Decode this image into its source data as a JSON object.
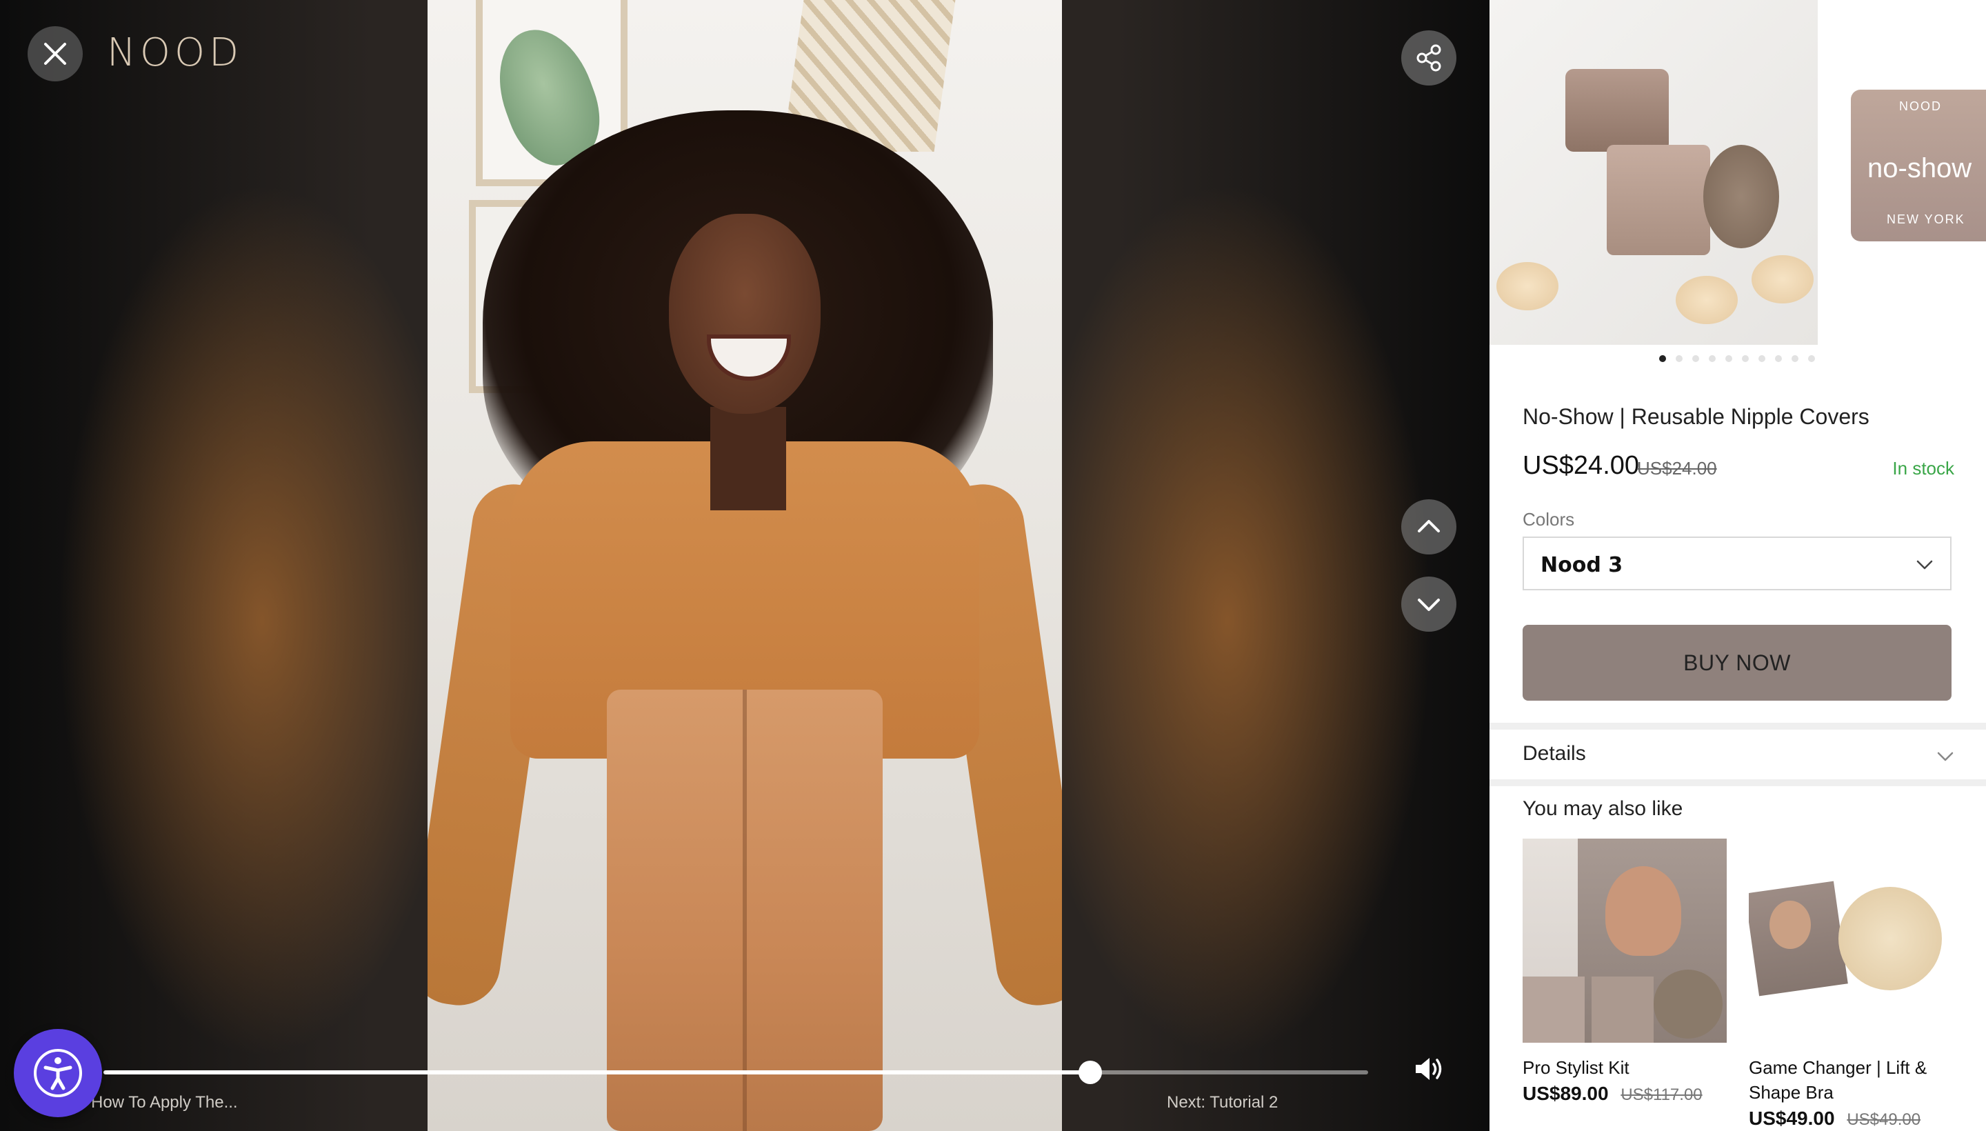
{
  "header": {
    "brand": "NOOD",
    "close_icon": "close-icon",
    "share_icon": "share-icon"
  },
  "video": {
    "prev_label": "How To Apply The...",
    "next_label": "Next: Tutorial 2",
    "progress": 0.78,
    "nav_up_icon": "chevron-up-icon",
    "nav_down_icon": "chevron-down-icon",
    "volume_icon": "volume-icon"
  },
  "accessibility": {
    "icon": "accessibility-icon"
  },
  "product": {
    "gallery": {
      "side_image_text": {
        "brand": "NOOD",
        "name": "no-show",
        "city": "NEW YORK"
      },
      "dot_count": 10,
      "active_dot": 0
    },
    "title": "No-Show | Reusable Nipple Covers",
    "price": "US$24.00",
    "compare_price": "US$24.00",
    "stock": "In stock",
    "colors_label": "Colors",
    "selected_color": "Nood 3",
    "buy_label": "BUY NOW",
    "details_label": "Details"
  },
  "recommendations": {
    "heading": "You may also like",
    "items": [
      {
        "name": "Pro Stylist Kit",
        "price": "US$89.00",
        "compare_price": "US$117.00"
      },
      {
        "name": "Game Changer | Lift & Shape Bra",
        "price": "US$49.00",
        "compare_price": "US$49.00"
      }
    ]
  },
  "colors": {
    "accent_button": "#8f817c",
    "in_stock": "#3aa648",
    "accessibility": "#5a3fe0"
  }
}
